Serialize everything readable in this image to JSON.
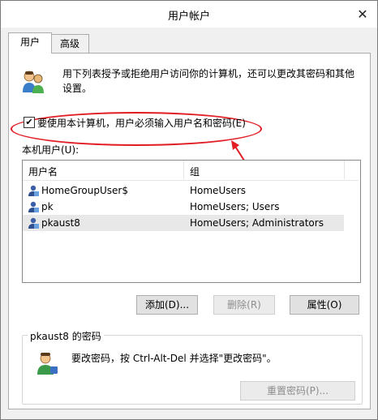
{
  "window": {
    "title": "用户帐户",
    "close_glyph": "✕"
  },
  "tabs": [
    {
      "label": "用户",
      "active": true
    },
    {
      "label": "高级",
      "active": false
    }
  ],
  "intro": {
    "text": "用下列表授予或拒绝用户访问你的计算机，还可以更改其密码和其他设置。"
  },
  "require_login": {
    "label": "要使用本计算机，用户必须输入用户名和密码(E)",
    "checked": true,
    "check_glyph": "✔"
  },
  "local_users": {
    "label": "本机用户(U):",
    "columns": [
      "用户名",
      "组"
    ],
    "rows": [
      {
        "name": "HomeGroupUser$",
        "group": "HomeUsers",
        "selected": false
      },
      {
        "name": "pk",
        "group": "HomeUsers; Users",
        "selected": false
      },
      {
        "name": "pkaust8",
        "group": "HomeUsers; Administrators",
        "selected": true
      }
    ]
  },
  "buttons": {
    "add": "添加(D)...",
    "remove": "删除(R)",
    "properties": "属性(O)"
  },
  "password_box": {
    "title": "pkaust8 的密码",
    "text": "要改密码，按 Ctrl-Alt-Del 并选择\"更改密码\"。",
    "reset_button": "重置密码(P)..."
  },
  "colors": {
    "annotation_red": "#e11c22",
    "selected_row": "#e8e8e8"
  }
}
